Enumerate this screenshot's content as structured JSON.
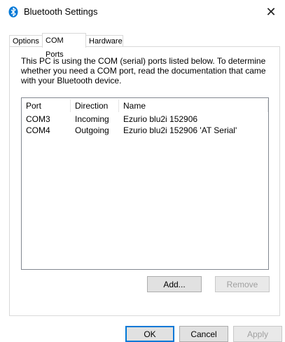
{
  "window": {
    "title": "Bluetooth Settings",
    "close_glyph": "✕",
    "title_icon": "bluetooth-icon",
    "accent": "#0078d7"
  },
  "tabs": [
    {
      "label": "Options",
      "active": false
    },
    {
      "label": "COM Ports",
      "active": true
    },
    {
      "label": "Hardware",
      "active": false
    }
  ],
  "com_ports": {
    "description": "This PC is using the COM (serial) ports listed below. To determine whether you need a COM port, read the documentation that came with your Bluetooth device.",
    "columns": [
      "Port",
      "Direction",
      "Name"
    ],
    "rows": [
      {
        "port": "COM3",
        "direction": "Incoming",
        "name": "Ezurio blu2i 152906"
      },
      {
        "port": "COM4",
        "direction": "Outgoing",
        "name": "Ezurio blu2i 152906 'AT Serial'"
      }
    ],
    "add_label": "Add...",
    "remove_label": "Remove"
  },
  "footer": {
    "ok_label": "OK",
    "cancel_label": "Cancel",
    "apply_label": "Apply"
  }
}
